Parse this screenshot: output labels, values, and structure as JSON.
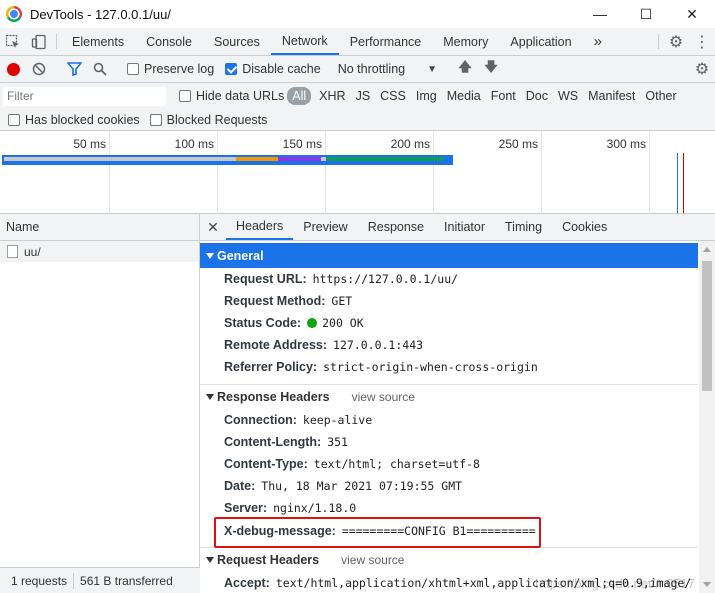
{
  "window": {
    "title": "DevTools - 127.0.0.1/uu/"
  },
  "tabs": [
    "Elements",
    "Console",
    "Sources",
    "Network",
    "Performance",
    "Memory",
    "Application"
  ],
  "active_tab": "Network",
  "toolbar": {
    "preserve_log": "Preserve log",
    "disable_cache": "Disable cache",
    "throttling": "No throttling"
  },
  "filter": {
    "placeholder": "Filter",
    "hide_data_urls": "Hide data URLs",
    "types": [
      "All",
      "XHR",
      "JS",
      "CSS",
      "Img",
      "Media",
      "Font",
      "Doc",
      "WS",
      "Manifest",
      "Other"
    ],
    "has_blocked_cookies": "Has blocked cookies",
    "blocked_requests": "Blocked Requests"
  },
  "overview": {
    "ticks": [
      "50 ms",
      "100 ms",
      "150 ms",
      "200 ms",
      "250 ms",
      "300 ms"
    ]
  },
  "requests": {
    "header": "Name",
    "items": [
      "uu/"
    ],
    "status": {
      "count": "1 requests",
      "transferred": "561 B transferred"
    }
  },
  "details": {
    "tabs": [
      "Headers",
      "Preview",
      "Response",
      "Initiator",
      "Timing",
      "Cookies"
    ],
    "active_tab": "Headers",
    "view_source": "view source",
    "general": {
      "title": "General",
      "rows": [
        {
          "k": "Request URL:",
          "v": "https://127.0.0.1/uu/"
        },
        {
          "k": "Request Method:",
          "v": "GET"
        },
        {
          "k": "Status Code:",
          "v": "200 OK"
        },
        {
          "k": "Remote Address:",
          "v": "127.0.0.1:443"
        },
        {
          "k": "Referrer Policy:",
          "v": "strict-origin-when-cross-origin"
        }
      ]
    },
    "response_headers": {
      "title": "Response Headers",
      "rows": [
        {
          "k": "Connection:",
          "v": "keep-alive"
        },
        {
          "k": "Content-Length:",
          "v": "351"
        },
        {
          "k": "Content-Type:",
          "v": "text/html; charset=utf-8"
        },
        {
          "k": "Date:",
          "v": "Thu, 18 Mar 2021 07:19:55 GMT"
        },
        {
          "k": "Server:",
          "v": "nginx/1.18.0"
        },
        {
          "k": "X-debug-message:",
          "v": "=========CONFIG B1=========="
        }
      ]
    },
    "request_headers": {
      "title": "Request Headers",
      "rows": [
        {
          "k": "Accept:",
          "v": "text/html,application/xhtml+xml,application/xml;q=0.9,image/"
        }
      ]
    }
  },
  "watermark": "https://blog.csdn.net/m0517",
  "colors": {
    "accent": "#1a73e8",
    "record": "#e00000",
    "highlight_box": "#e01010",
    "status_ok": "#0ca40c"
  }
}
